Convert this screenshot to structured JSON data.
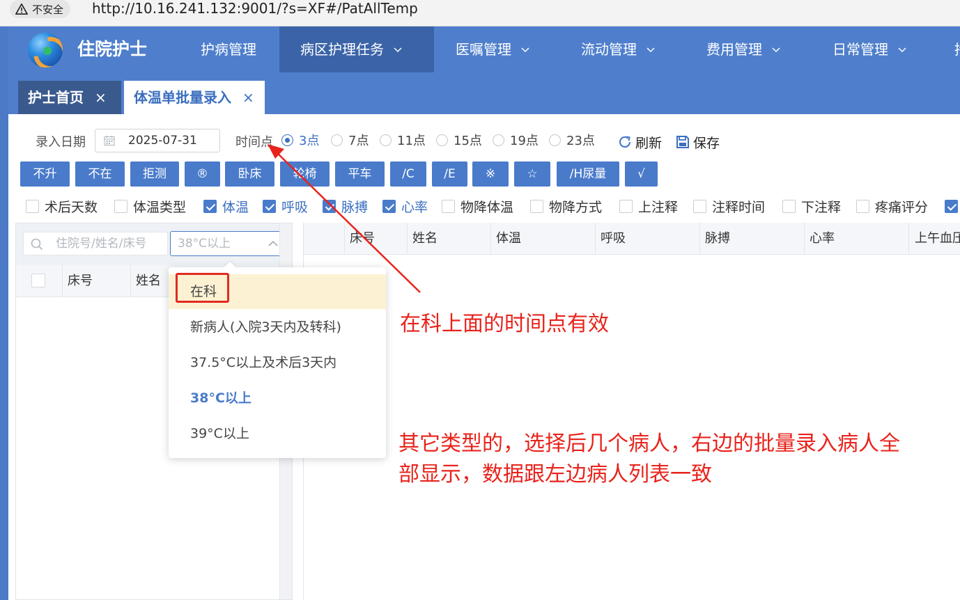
{
  "browser": {
    "security_label": "不安全",
    "url": "http://10.16.241.132:9001/?s=XF#/PatAllTemp"
  },
  "app": {
    "title": "住院护士",
    "nav": [
      {
        "label": "护病管理",
        "has_chevron": false,
        "active": false
      },
      {
        "label": "病区护理任务",
        "has_chevron": true,
        "active": true
      },
      {
        "label": "医嘱管理",
        "has_chevron": true,
        "active": false
      },
      {
        "label": "流动管理",
        "has_chevron": true,
        "active": false
      },
      {
        "label": "费用管理",
        "has_chevron": true,
        "active": false
      },
      {
        "label": "日常管理",
        "has_chevron": true,
        "active": false
      }
    ],
    "nav_overflow": "持"
  },
  "tabs": [
    {
      "label": "护士首页",
      "close": "×"
    },
    {
      "label": "体温单批量录入",
      "close": "×"
    }
  ],
  "toolbar": {
    "date_label": "录入日期",
    "date_value": "2025-07-31",
    "time_label": "时间点",
    "time_points": [
      {
        "label": "3点",
        "checked": true
      },
      {
        "label": "7点",
        "checked": false
      },
      {
        "label": "11点",
        "checked": false
      },
      {
        "label": "15点",
        "checked": false
      },
      {
        "label": "19点",
        "checked": false
      },
      {
        "label": "23点",
        "checked": false
      }
    ],
    "refresh_label": "刷新",
    "save_label": "保存"
  },
  "quick_buttons": [
    "不升",
    "不在",
    "拒测",
    "®",
    "卧床",
    "轮椅",
    "平车",
    "/C",
    "/E",
    "※",
    "☆",
    "/H尿量",
    "√"
  ],
  "columns_toggle": [
    {
      "label": "术后天数",
      "checked": false
    },
    {
      "label": "体温类型",
      "checked": false
    },
    {
      "label": "体温",
      "checked": true
    },
    {
      "label": "呼吸",
      "checked": true
    },
    {
      "label": "脉搏",
      "checked": true
    },
    {
      "label": "心率",
      "checked": true
    },
    {
      "label": "物降体温",
      "checked": false
    },
    {
      "label": "物降方式",
      "checked": false
    },
    {
      "label": "上注释",
      "checked": false
    },
    {
      "label": "注释时间",
      "checked": false
    },
    {
      "label": "下注释",
      "checked": false
    },
    {
      "label": "疼痛评分",
      "checked": false
    }
  ],
  "left_panel": {
    "search_placeholder": "住院号/姓名/床号",
    "filter_value": "38°C以上",
    "headers": [
      "床号",
      "姓名"
    ]
  },
  "dropdown": {
    "options": [
      {
        "label": "在科",
        "hover": true,
        "selected": false
      },
      {
        "label": "新病人(入院3天内及转科)",
        "hover": false,
        "selected": false
      },
      {
        "label": "37.5°C以上及术后3天内",
        "hover": false,
        "selected": false
      },
      {
        "label": "38°C以上",
        "hover": false,
        "selected": true
      },
      {
        "label": "39°C以上",
        "hover": false,
        "selected": false
      }
    ]
  },
  "right_panel": {
    "headers": [
      "床号",
      "姓名",
      "体温",
      "呼吸",
      "脉搏",
      "心率",
      "上午血压"
    ]
  },
  "annotations": {
    "note1": "在科上面的时间点有效",
    "note2_line1": "其它类型的，选择后几个病人，右边的批量录入病人全",
    "note2_line2": "部显示，数据跟左边病人列表一致",
    "color": "#e8231b"
  },
  "colors": {
    "header_blue": "#4f7fcc",
    "active_nav": "#3b64a8",
    "button_blue": "#4a7bcb",
    "accent_text": "#3b6fbf"
  }
}
